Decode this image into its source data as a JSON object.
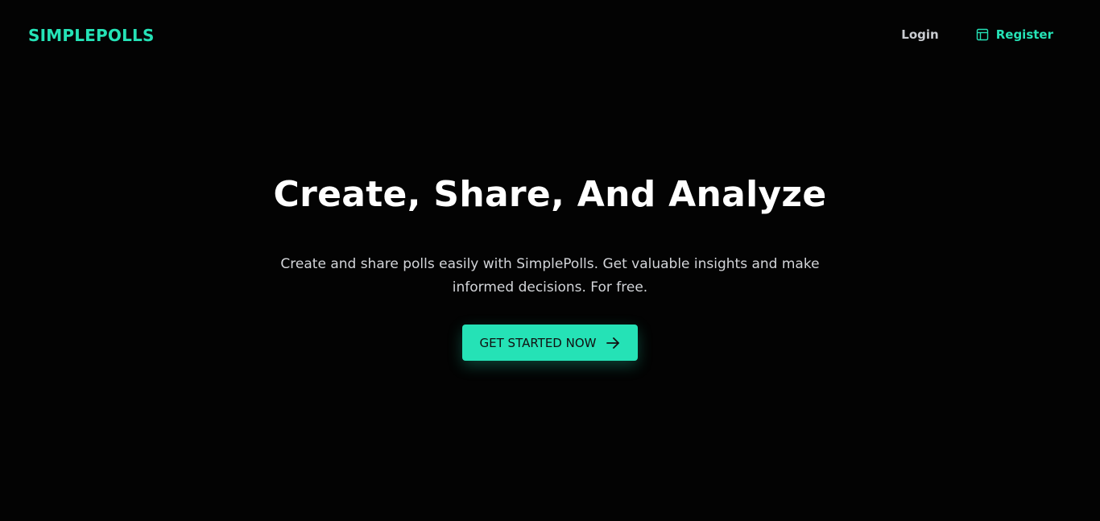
{
  "brand": {
    "name": "SIMPLEPOLLS",
    "accent_color": "#25e2b6",
    "background_color": "#030303"
  },
  "nav": {
    "login_label": "Login",
    "register_label": "Register",
    "register_icon": "layout-icon"
  },
  "hero": {
    "title": "Create, Share, And Analyze",
    "subtitle": "Create and share polls easily with SimplePolls. Get valuable insights and make informed decisions. For free.",
    "cta_label": "GET STARTED NOW",
    "cta_icon": "arrow-right-icon"
  }
}
